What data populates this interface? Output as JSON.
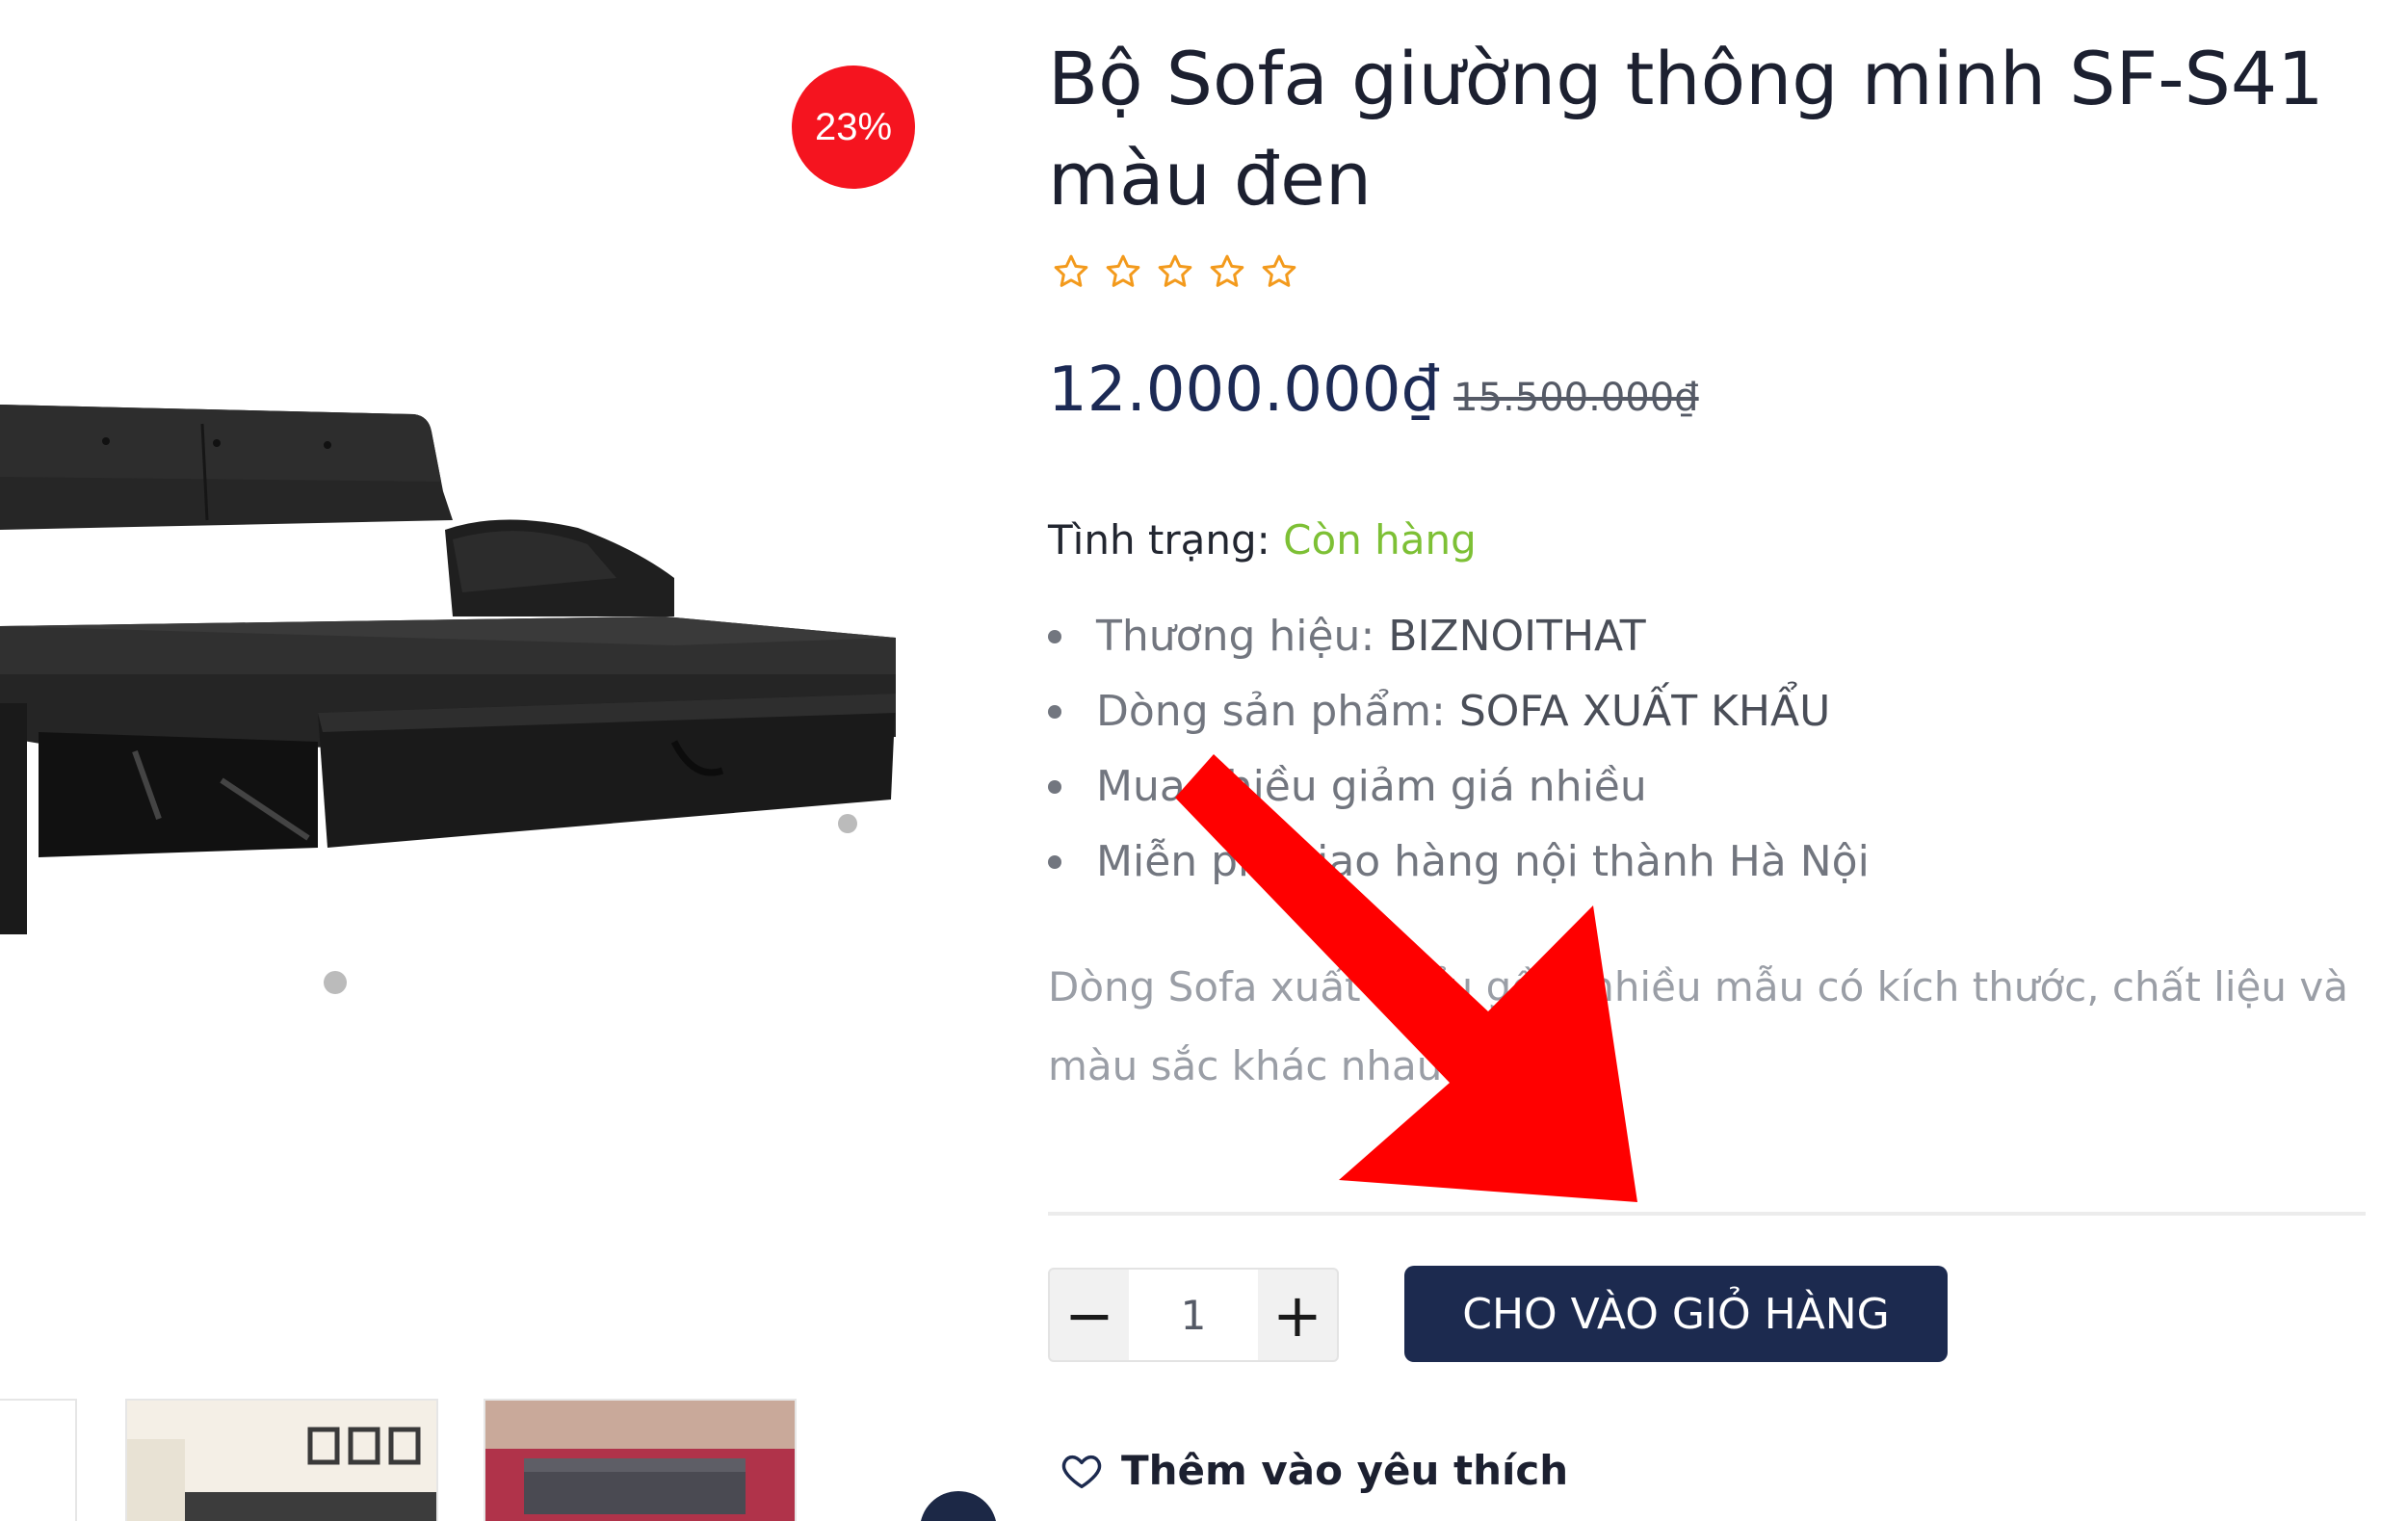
{
  "product": {
    "title": "Bộ Sofa giường thông minh SF-S41 màu đen",
    "discount_badge": "23%",
    "rating_stars": 0,
    "rating_max": 5,
    "price_current": "12.000.000₫",
    "price_old": "15.500.000₫",
    "stock_label": "Tình trạng: ",
    "stock_value": "Còn hàng",
    "specs": [
      {
        "label": "Thương hiệu: ",
        "value": "BIZNOITHAT"
      },
      {
        "label": "Dòng sản phẩm: ",
        "value": "SOFA XUẤT KHẨU"
      },
      {
        "label": "Mua nhiều giảm giá nhiều",
        "value": ""
      },
      {
        "label": "Miễn phí giao hàng nội thành Hà Nội",
        "value": ""
      }
    ],
    "short_description": "Dòng Sofa xuất khẩu gồm nhiều mẫu có kích thước, chất liệu và màu sắc khác nhau....",
    "quantity": "1",
    "qty_minus": "−",
    "qty_plus": "+",
    "add_to_cart_label": "CHO VÀO GIỎ HÀNG",
    "wishlist_label": "Thêm vào yêu thích"
  },
  "colors": {
    "badge": "#f5141f",
    "price": "#1c2a55",
    "in_stock": "#7dc035",
    "button": "#1c2a4f",
    "star": "#f39a1c",
    "arrow": "#ff0000"
  },
  "icons": {
    "star": "star-outline-icon",
    "wishlist": "heart-outline-icon",
    "carousel_next": "chevron-right-icon",
    "annotation": "red-arrow"
  }
}
